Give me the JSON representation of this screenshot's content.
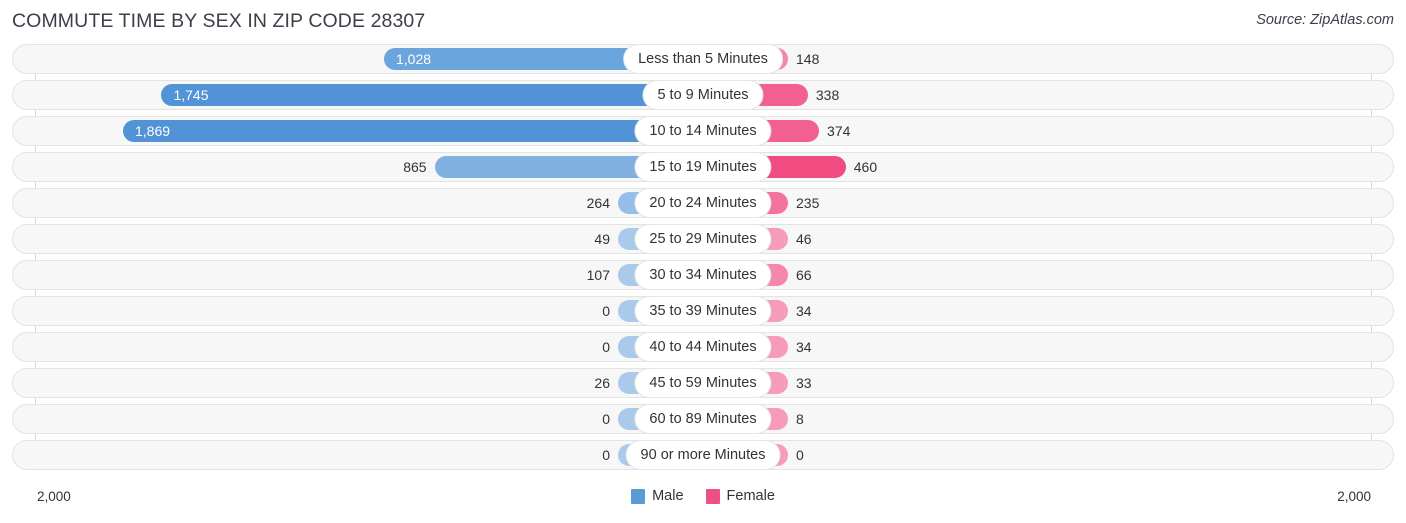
{
  "header": {
    "title": "COMMUTE TIME BY SEX IN ZIP CODE 28307",
    "source": "Source: ZipAtlas.com"
  },
  "axis": {
    "left_label": "2,000",
    "right_label": "2,000",
    "max": 2000
  },
  "legend": {
    "male": "Male",
    "female": "Female",
    "male_color": "#5b9bd5",
    "female_color": "#ee4f88"
  },
  "chart_data": {
    "type": "bar",
    "orientation": "horizontal-diverging",
    "title": "COMMUTE TIME BY SEX IN ZIP CODE 28307",
    "xlabel": "",
    "ylabel": "",
    "xlim": [
      2000,
      2000
    ],
    "grid": true,
    "legend_position": "bottom-center",
    "categories": [
      "Less than 5 Minutes",
      "5 to 9 Minutes",
      "10 to 14 Minutes",
      "15 to 19 Minutes",
      "20 to 24 Minutes",
      "25 to 29 Minutes",
      "30 to 34 Minutes",
      "35 to 39 Minutes",
      "40 to 44 Minutes",
      "45 to 59 Minutes",
      "60 to 89 Minutes",
      "90 or more Minutes"
    ],
    "series": [
      {
        "name": "Male",
        "values": [
          1028,
          1745,
          1869,
          865,
          264,
          49,
          107,
          0,
          0,
          26,
          0,
          0
        ],
        "labels": [
          "1,028",
          "1,745",
          "1,869",
          "865",
          "264",
          "49",
          "107",
          "0",
          "0",
          "26",
          "0",
          "0"
        ]
      },
      {
        "name": "Female",
        "values": [
          148,
          338,
          374,
          460,
          235,
          46,
          66,
          34,
          34,
          33,
          8,
          0
        ],
        "labels": [
          "148",
          "338",
          "374",
          "460",
          "235",
          "46",
          "66",
          "34",
          "34",
          "33",
          "8",
          "0"
        ]
      }
    ]
  }
}
